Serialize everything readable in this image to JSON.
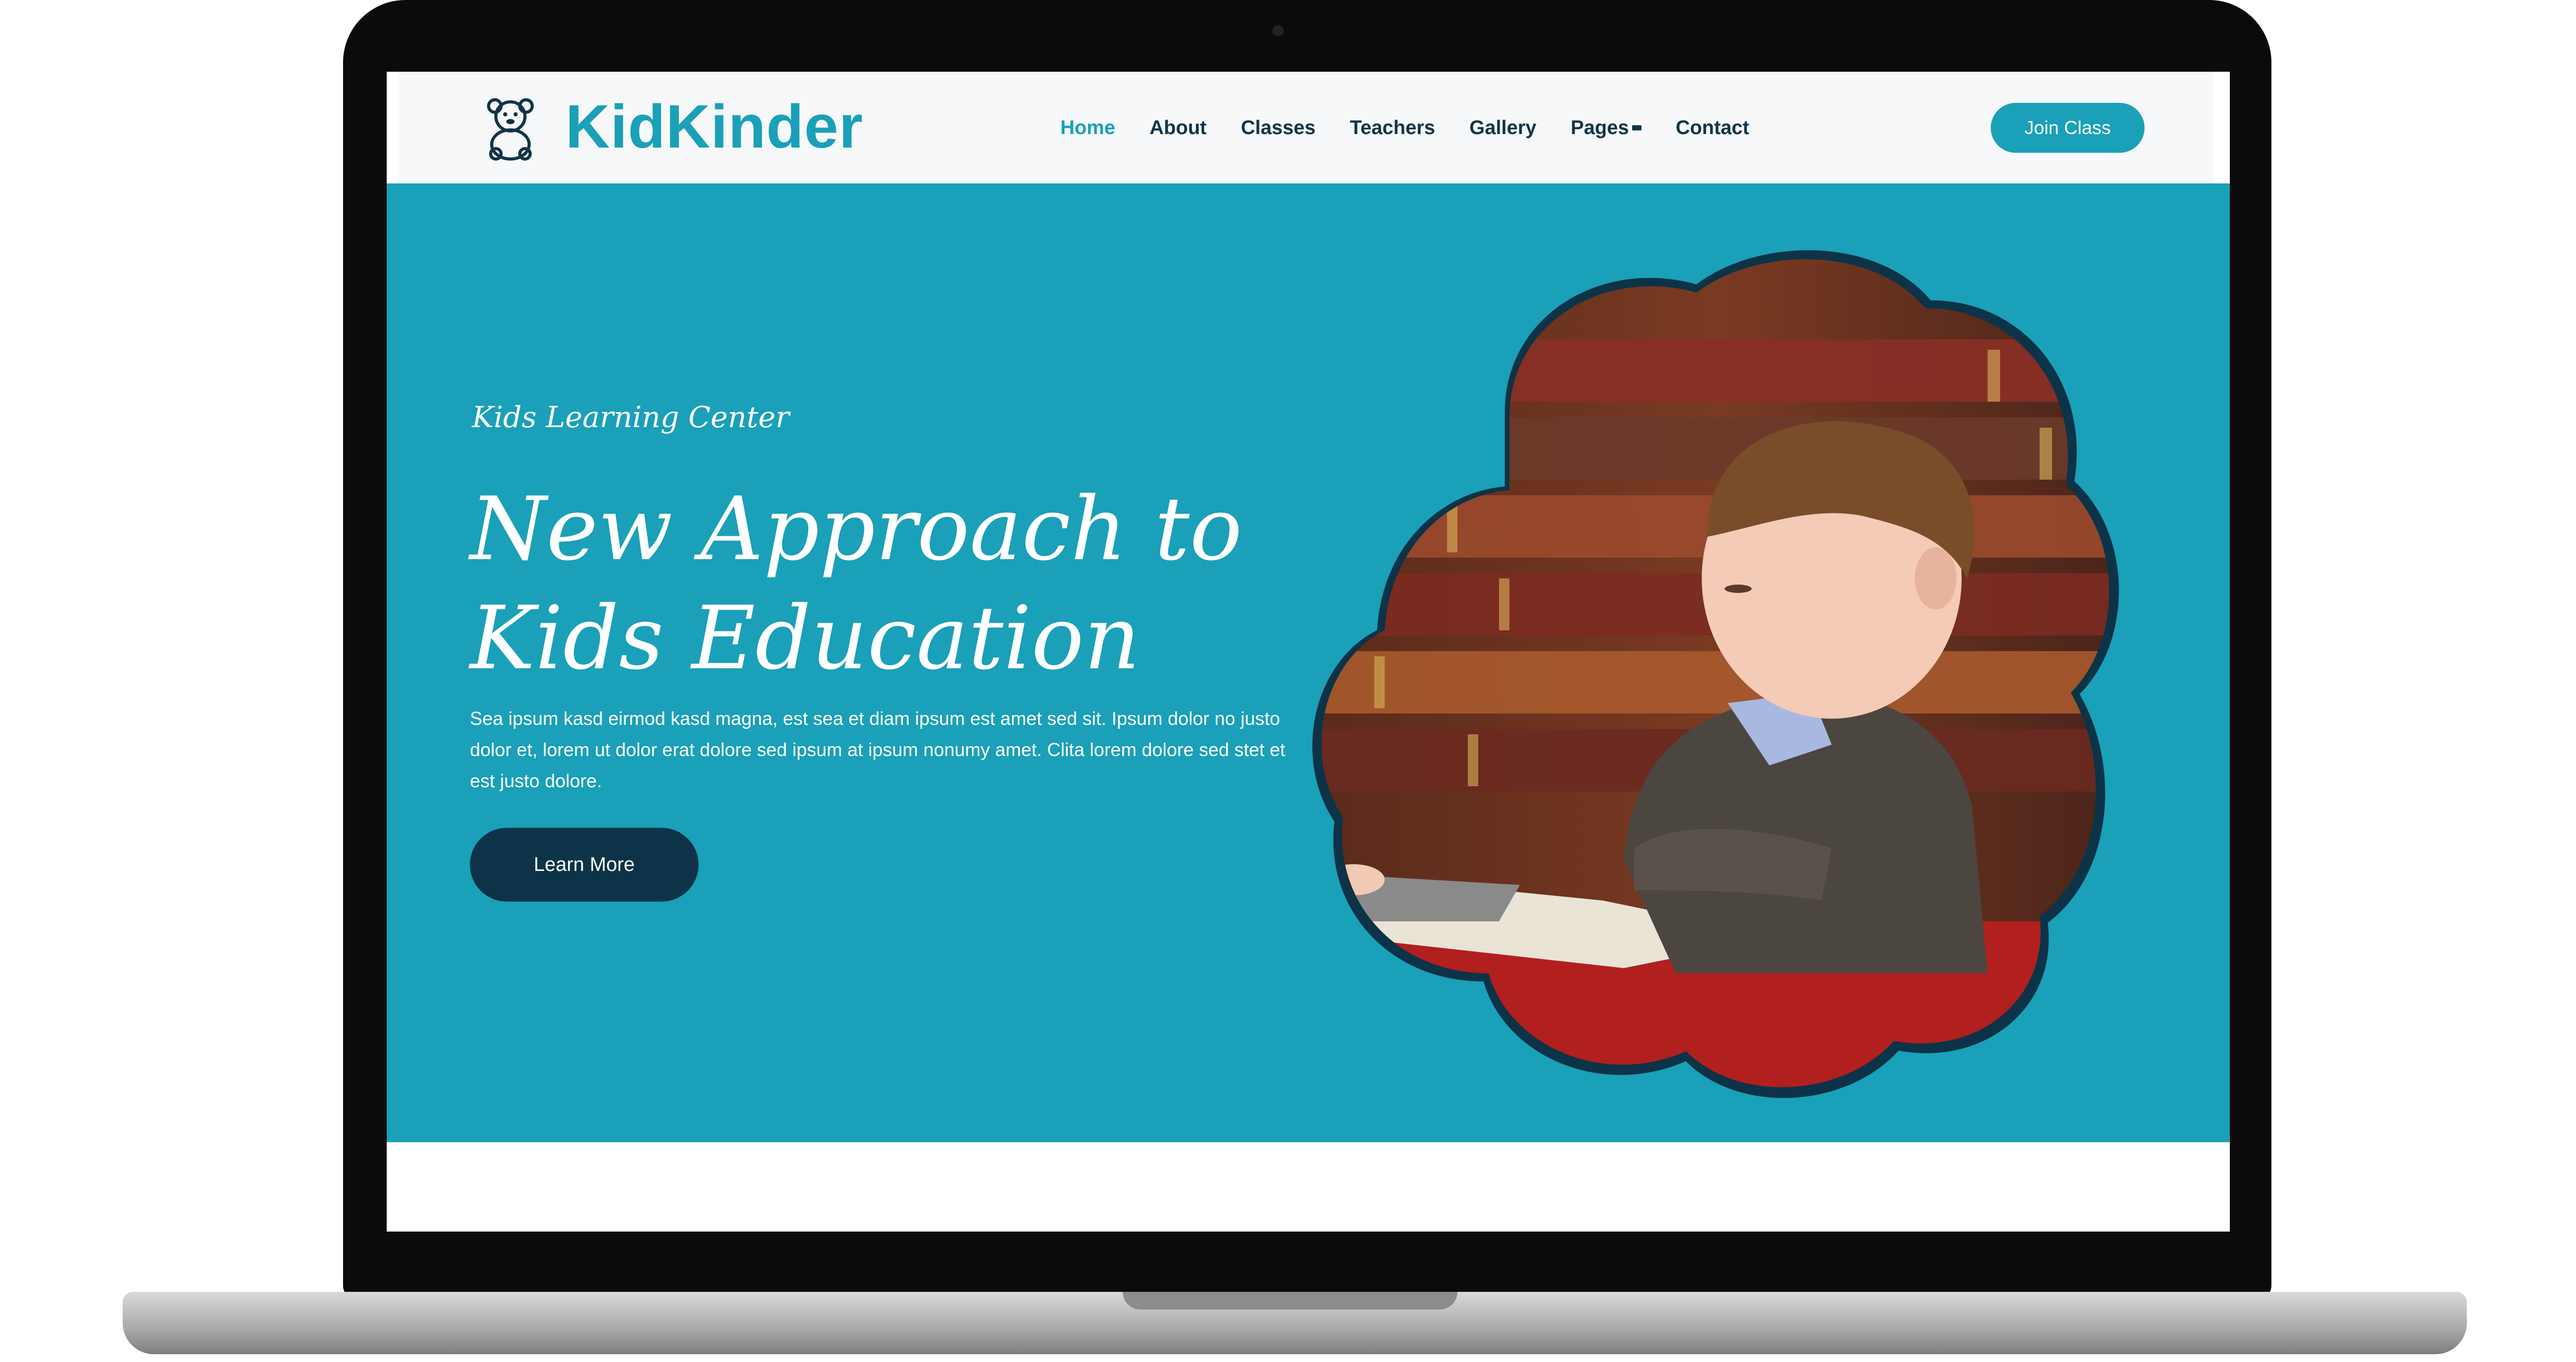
{
  "brand": {
    "name": "KidKinder",
    "logo_icon": "teddy-bear-icon",
    "color": "#1aa0b8"
  },
  "nav": {
    "items": [
      {
        "label": "Home",
        "active": true
      },
      {
        "label": "About"
      },
      {
        "label": "Classes"
      },
      {
        "label": "Teachers"
      },
      {
        "label": "Gallery"
      },
      {
        "label": "Pages",
        "has_dropdown": true
      },
      {
        "label": "Contact"
      }
    ],
    "cta": "Join Class"
  },
  "hero": {
    "subtitle": "Kids Learning Center",
    "title_line1": "New Approach to",
    "title_line2": "Kids Education",
    "description": "Sea ipsum kasd eirmod kasd magna, est sea et diam ipsum est amet sed sit. Ipsum dolor no justo dolor et, lorem ut dolor erat dolore sed ipsum at ipsum nonumy amet. Clita lorem dolore sed stet et est justo dolore.",
    "button": "Learn More",
    "background": "#1aa0b8",
    "button_color": "#0c3347",
    "image": "boy-reading-book-photo"
  }
}
